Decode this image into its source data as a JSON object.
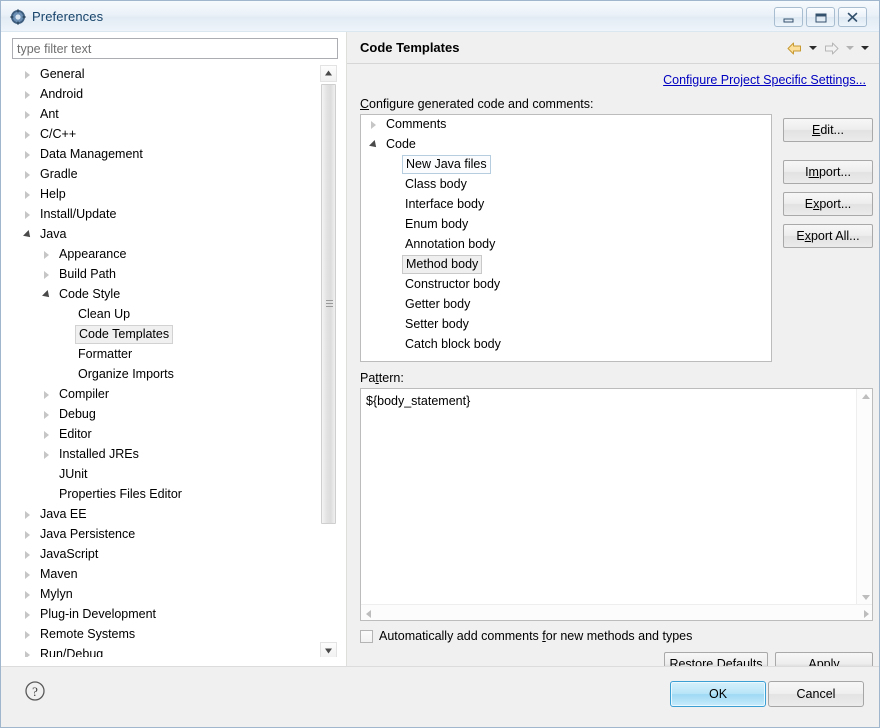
{
  "window": {
    "title": "Preferences",
    "icon": "preferences-gear-icon",
    "controls": {
      "minimize": "minimize-icon",
      "maximize": "maximize-icon",
      "close": "close-icon"
    }
  },
  "sidebar": {
    "filter": {
      "value": "",
      "placeholder": "type filter text"
    },
    "items": [
      {
        "label": "General",
        "indent": 0,
        "state": "collapsed"
      },
      {
        "label": "Android",
        "indent": 0,
        "state": "collapsed"
      },
      {
        "label": "Ant",
        "indent": 0,
        "state": "collapsed"
      },
      {
        "label": "C/C++",
        "indent": 0,
        "state": "collapsed"
      },
      {
        "label": "Data Management",
        "indent": 0,
        "state": "collapsed"
      },
      {
        "label": "Gradle",
        "indent": 0,
        "state": "collapsed"
      },
      {
        "label": "Help",
        "indent": 0,
        "state": "collapsed"
      },
      {
        "label": "Install/Update",
        "indent": 0,
        "state": "collapsed"
      },
      {
        "label": "Java",
        "indent": 0,
        "state": "expanded"
      },
      {
        "label": "Appearance",
        "indent": 1,
        "state": "collapsed"
      },
      {
        "label": "Build Path",
        "indent": 1,
        "state": "collapsed"
      },
      {
        "label": "Code Style",
        "indent": 1,
        "state": "expanded"
      },
      {
        "label": "Clean Up",
        "indent": 2,
        "state": "leaf"
      },
      {
        "label": "Code Templates",
        "indent": 2,
        "state": "leaf",
        "selected": true
      },
      {
        "label": "Formatter",
        "indent": 2,
        "state": "leaf"
      },
      {
        "label": "Organize Imports",
        "indent": 2,
        "state": "leaf"
      },
      {
        "label": "Compiler",
        "indent": 1,
        "state": "collapsed"
      },
      {
        "label": "Debug",
        "indent": 1,
        "state": "collapsed"
      },
      {
        "label": "Editor",
        "indent": 1,
        "state": "collapsed"
      },
      {
        "label": "Installed JREs",
        "indent": 1,
        "state": "collapsed"
      },
      {
        "label": "JUnit",
        "indent": 1,
        "state": "leaf"
      },
      {
        "label": "Properties Files Editor",
        "indent": 1,
        "state": "leaf"
      },
      {
        "label": "Java EE",
        "indent": 0,
        "state": "collapsed"
      },
      {
        "label": "Java Persistence",
        "indent": 0,
        "state": "collapsed"
      },
      {
        "label": "JavaScript",
        "indent": 0,
        "state": "collapsed"
      },
      {
        "label": "Maven",
        "indent": 0,
        "state": "collapsed"
      },
      {
        "label": "Mylyn",
        "indent": 0,
        "state": "collapsed"
      },
      {
        "label": "Plug-in Development",
        "indent": 0,
        "state": "collapsed"
      },
      {
        "label": "Remote Systems",
        "indent": 0,
        "state": "collapsed"
      },
      {
        "label": "Run/Debug",
        "indent": 0,
        "state": "collapsed"
      }
    ]
  },
  "page": {
    "title": "Code Templates",
    "nav": {
      "back": "back-arrow-icon",
      "back_menu": "chevron-down-icon",
      "forward": "forward-arrow-icon",
      "forward_menu": "chevron-down-icon",
      "view_menu": "chevron-down-icon"
    },
    "project_settings_link": "Configure Project Specific Settings...",
    "configure_label": "Configure generated code and comments:",
    "templates": [
      {
        "label": "Comments",
        "indent": 0,
        "state": "collapsed"
      },
      {
        "label": "Code",
        "indent": 0,
        "state": "expanded"
      },
      {
        "label": "New Java files",
        "indent": 1,
        "state": "leaf",
        "focused": true
      },
      {
        "label": "Class body",
        "indent": 1,
        "state": "leaf"
      },
      {
        "label": "Interface body",
        "indent": 1,
        "state": "leaf"
      },
      {
        "label": "Enum body",
        "indent": 1,
        "state": "leaf"
      },
      {
        "label": "Annotation body",
        "indent": 1,
        "state": "leaf"
      },
      {
        "label": "Method body",
        "indent": 1,
        "state": "leaf",
        "selected": true
      },
      {
        "label": "Constructor body",
        "indent": 1,
        "state": "leaf"
      },
      {
        "label": "Getter body",
        "indent": 1,
        "state": "leaf"
      },
      {
        "label": "Setter body",
        "indent": 1,
        "state": "leaf"
      },
      {
        "label": "Catch block body",
        "indent": 1,
        "state": "leaf"
      }
    ],
    "side_buttons": {
      "edit": "Edit...",
      "import": "Import...",
      "export": "Export...",
      "export_all": "Export All..."
    },
    "pattern_label": "Pattern:",
    "pattern_value": "${body_statement}",
    "auto_comments_label": "Automatically add comments for new methods and types",
    "auto_comments_checked": false,
    "restore_defaults": "Restore Defaults",
    "apply": "Apply"
  },
  "footer": {
    "help": "help-icon",
    "ok": "OK",
    "cancel": "Cancel"
  },
  "colors": {
    "accent_link": "#0000c0",
    "default_button": "#9ed9f4",
    "dialog_bg": "#f0f0f0",
    "title_text": "#17446b"
  }
}
